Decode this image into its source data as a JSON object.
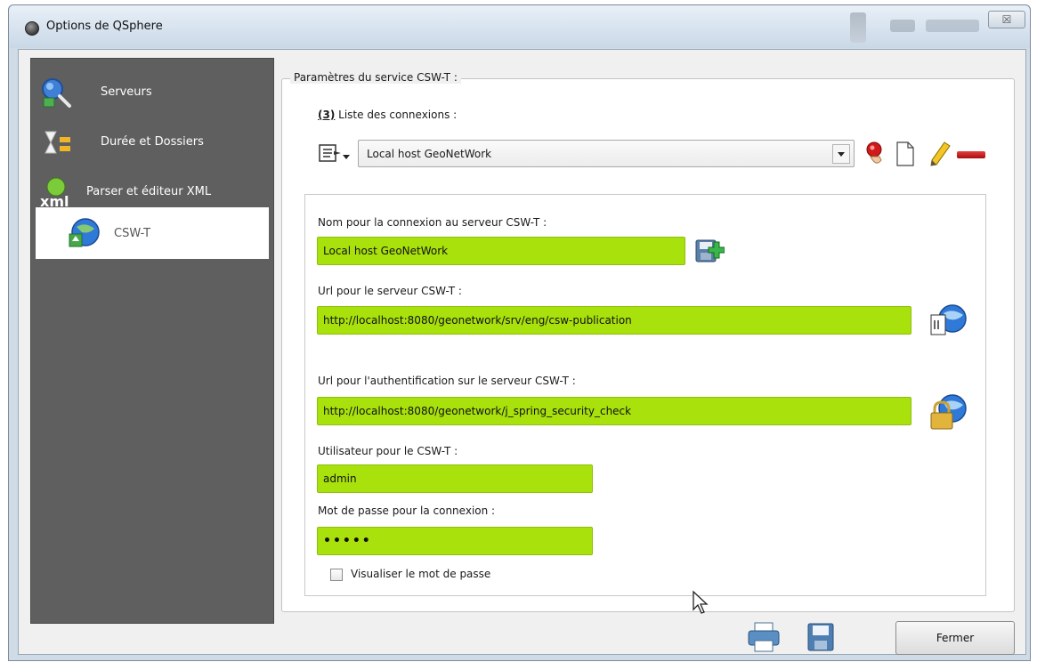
{
  "window": {
    "title": "Options de QSphere",
    "close_glyph": "☒"
  },
  "sidebar": {
    "items": [
      {
        "label": "Serveurs",
        "icon": "search-globe-icon"
      },
      {
        "label": "Durée et Dossiers",
        "icon": "hourglass-folder-icon"
      },
      {
        "label": "Parser et éditeur XML",
        "icon": "xml-icon"
      },
      {
        "label": "CSW-T",
        "icon": "globe-upload-icon",
        "selected": true
      }
    ]
  },
  "group": {
    "title": "Paramètres du service CSW-T :",
    "list_label_prefix": "(3)",
    "list_label": " Liste des connexions :",
    "connection_select": "Local host GeoNetWork",
    "toolbar_icons": [
      "connect-pin-icon",
      "new-document-icon",
      "pencil-icon",
      "remove-icon"
    ]
  },
  "form": {
    "name_label": "Nom pour la connexion au serveur CSW-T :",
    "name_value": "Local host GeoNetWork",
    "url_label": "Url pour le serveur CSW-T :",
    "url_value": "http://localhost:8080/geonetwork/srv/eng/csw-publication",
    "auth_label": "Url pour l'authentification sur le serveur CSW-T :",
    "auth_value": "http://localhost:8080/geonetwork/j_spring_security_check",
    "user_label": "Utilisateur pour le CSW-T :",
    "user_value": "admin",
    "password_label": "Mot de passe pour la connexion :",
    "password_value": "•••••",
    "show_password_label": "Visualiser le mot de passe",
    "show_password_checked": false
  },
  "footer": {
    "close_label": "Fermer"
  },
  "colors": {
    "field_green": "#a8e10c",
    "sidebar_bg": "#5f5f5f"
  }
}
